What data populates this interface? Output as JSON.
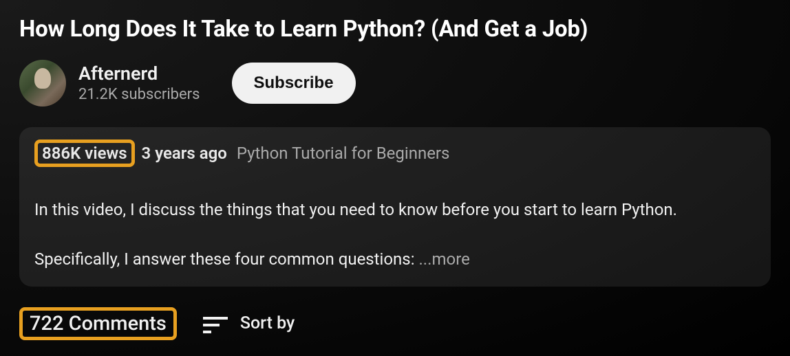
{
  "video": {
    "title": "How Long Does It Take to Learn Python? (And Get a Job)"
  },
  "channel": {
    "name": "Afternerd",
    "subscribers": "21.2K subscribers"
  },
  "actions": {
    "subscribe": "Subscribe"
  },
  "description": {
    "views": "886K views",
    "age": "3 years ago",
    "playlist": "Python Tutorial for Beginners",
    "line1": "In this video, I discuss the things that you need to know before you start to learn Python.",
    "line2": "Specifically, I answer these four common questions: ",
    "more": "...more"
  },
  "comments": {
    "count_label": "722 Comments",
    "sort_label": "Sort by"
  },
  "highlight_color": "#e8a020"
}
